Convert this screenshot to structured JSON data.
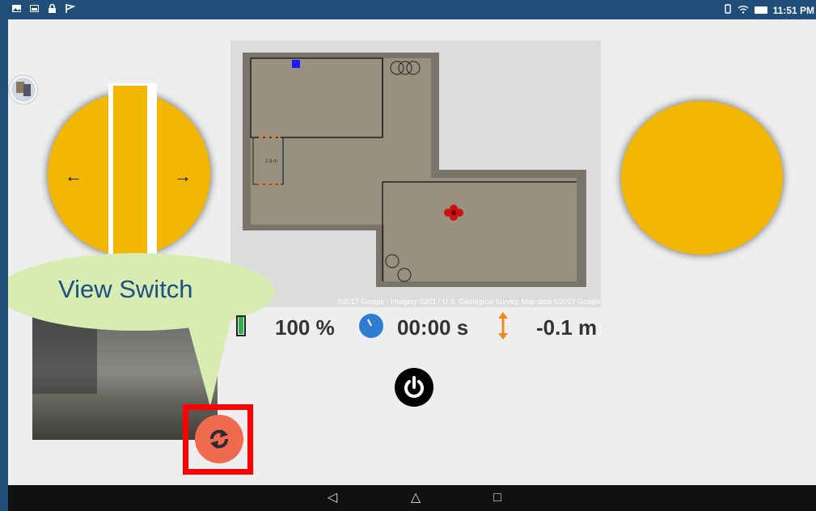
{
  "status_bar": {
    "time": "11:51 PM",
    "left_icons": [
      "gallery-icon",
      "image-icon",
      "lock-icon",
      "flag-icon"
    ],
    "right_icons": [
      "vibrate-icon",
      "wifi-icon",
      "battery-icon"
    ]
  },
  "map": {
    "credit": "©2017 Google · Imagery ©2017 U.S. Geological Survey, Map data ©2017 Google",
    "dimension_label": "2.8 m"
  },
  "callout": {
    "text": "View Switch"
  },
  "telemetry": {
    "battery": "100 %",
    "timer": "00:00 s",
    "altitude": "-0.1 m",
    "battery_level_percent": 100
  },
  "colors": {
    "joystick": "#f2b705",
    "highlight": "#ff0000",
    "switch_button": "#f06a50",
    "callout": "#d6ecb0",
    "callout_text": "#1c4f86",
    "map_background": "#dcdcdc"
  }
}
